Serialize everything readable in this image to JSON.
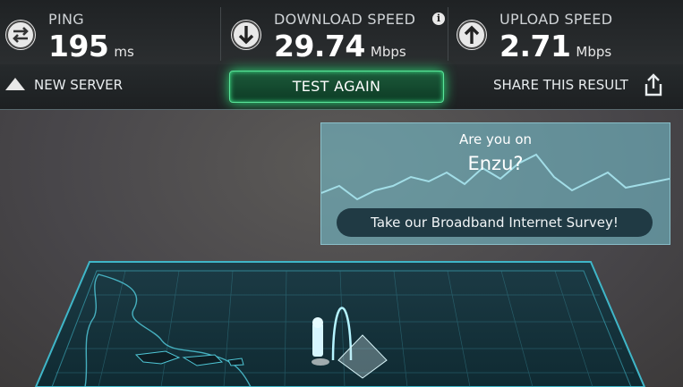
{
  "stats": {
    "ping": {
      "label": "PING",
      "value": "195",
      "unit": "ms",
      "icon": "ping-arrows-icon"
    },
    "download": {
      "label": "DOWNLOAD SPEED",
      "value": "29.74",
      "unit": "Mbps",
      "icon": "download-arrow-icon",
      "info_icon": "i"
    },
    "upload": {
      "label": "UPLOAD SPEED",
      "value": "2.71",
      "unit": "Mbps",
      "icon": "upload-arrow-icon"
    }
  },
  "toolbar": {
    "new_server": "NEW SERVER",
    "test_again": "TEST AGAIN",
    "share": "SHARE THIS RESULT"
  },
  "survey": {
    "line1": "Are you on",
    "line2": "Enzu?",
    "cta": "Take our Broadband Internet Survey!"
  },
  "colors": {
    "accent_green": "#2ee07a",
    "survey_teal": "#78c8d7",
    "map_cyan": "#3fb6c8"
  }
}
